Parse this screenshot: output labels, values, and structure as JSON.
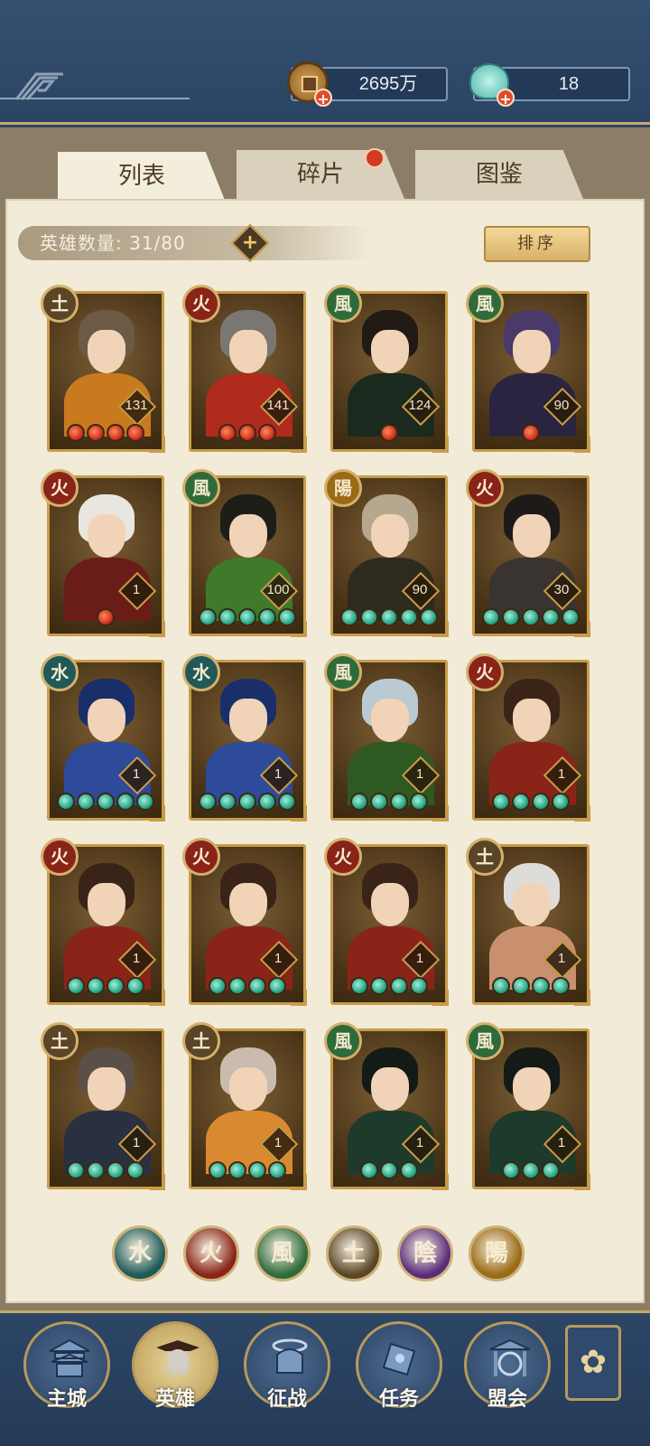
{
  "resources": {
    "coin": "2695万",
    "jade": "18"
  },
  "tabs": [
    {
      "label": "列表",
      "active": true
    },
    {
      "label": "碎片",
      "active": false,
      "has_dot": true
    },
    {
      "label": "图鉴",
      "active": false
    }
  ],
  "hero_count_label": "英雄数量: 31/80",
  "sort_label": "排序",
  "elements": {
    "tu": "土",
    "huo": "火",
    "feng": "風",
    "shui": "水",
    "yin": "陰",
    "yang": "陽"
  },
  "element_colors": {
    "tu": "#5a4526",
    "huo": "#8a2418",
    "feng": "#2f6a3a",
    "shui": "#1f5a58",
    "yin": "#5b2c7a",
    "yang": "#9a6a14"
  },
  "heroes": [
    {
      "element": "tu",
      "level": "131",
      "stars": 4,
      "star_color": "red",
      "hair": "#6d5a46",
      "body": "#c97a1f"
    },
    {
      "element": "huo",
      "level": "141",
      "stars": 3,
      "star_color": "red",
      "hair": "#7a7773",
      "body": "#b12a1e"
    },
    {
      "element": "feng",
      "level": "124",
      "stars": 1,
      "star_color": "red",
      "hair": "#221a14",
      "body": "#1b2a1e"
    },
    {
      "element": "feng",
      "level": "90",
      "stars": 1,
      "star_color": "red",
      "hair": "#4a3a6a",
      "body": "#2a2440"
    },
    {
      "element": "huo",
      "level": "1",
      "stars": 1,
      "star_color": "red",
      "hair": "#e9e6e0",
      "body": "#6a1d16"
    },
    {
      "element": "feng",
      "level": "100",
      "stars": 5,
      "star_color": "jade",
      "hair": "#1e1e18",
      "body": "#3e7a2a"
    },
    {
      "element": "yang",
      "level": "90",
      "stars": 5,
      "star_color": "jade",
      "hair": "#b6a88e",
      "body": "#2e2a1e"
    },
    {
      "element": "huo",
      "level": "30",
      "stars": 5,
      "star_color": "jade",
      "hair": "#1e1a18",
      "body": "#3a3430"
    },
    {
      "element": "shui",
      "level": "1",
      "stars": 5,
      "star_color": "jade",
      "hair": "#1a2e6a",
      "body": "#2e4a9a"
    },
    {
      "element": "shui",
      "level": "1",
      "stars": 5,
      "star_color": "jade",
      "hair": "#1a2e6a",
      "body": "#2e4a9a"
    },
    {
      "element": "feng",
      "level": "1",
      "stars": 4,
      "star_color": "jade",
      "hair": "#b9cad2",
      "body": "#2e5a22"
    },
    {
      "element": "huo",
      "level": "1",
      "stars": 4,
      "star_color": "jade",
      "hair": "#3a2418",
      "body": "#8a2418"
    },
    {
      "element": "huo",
      "level": "1",
      "stars": 4,
      "star_color": "jade",
      "hair": "#3a2418",
      "body": "#8a2418"
    },
    {
      "element": "huo",
      "level": "1",
      "stars": 4,
      "star_color": "jade",
      "hair": "#3a2418",
      "body": "#8a2418"
    },
    {
      "element": "huo",
      "level": "1",
      "stars": 4,
      "star_color": "jade",
      "hair": "#3a2418",
      "body": "#8a2418"
    },
    {
      "element": "tu",
      "level": "1",
      "stars": 4,
      "star_color": "jade",
      "hair": "#dedcd8",
      "body": "#c99070"
    },
    {
      "element": "tu",
      "level": "1",
      "stars": 4,
      "star_color": "jade",
      "hair": "#5a5048",
      "body": "#2a3040"
    },
    {
      "element": "tu",
      "level": "1",
      "stars": 4,
      "star_color": "jade",
      "hair": "#c9bcae",
      "body": "#d98a30"
    },
    {
      "element": "feng",
      "level": "1",
      "stars": 3,
      "star_color": "jade",
      "hair": "#141a16",
      "body": "#1e3a2a"
    },
    {
      "element": "feng",
      "level": "1",
      "stars": 3,
      "star_color": "jade",
      "hair": "#141a16",
      "body": "#1e3a2a"
    }
  ],
  "filters": [
    "shui",
    "huo",
    "feng",
    "tu",
    "yin",
    "yang"
  ],
  "nav": [
    {
      "label": "主城",
      "active": false
    },
    {
      "label": "英雄",
      "active": true
    },
    {
      "label": "征战",
      "active": false
    },
    {
      "label": "任务",
      "active": false
    },
    {
      "label": "盟会",
      "active": false
    }
  ],
  "side_button_icon": "clover-icon"
}
